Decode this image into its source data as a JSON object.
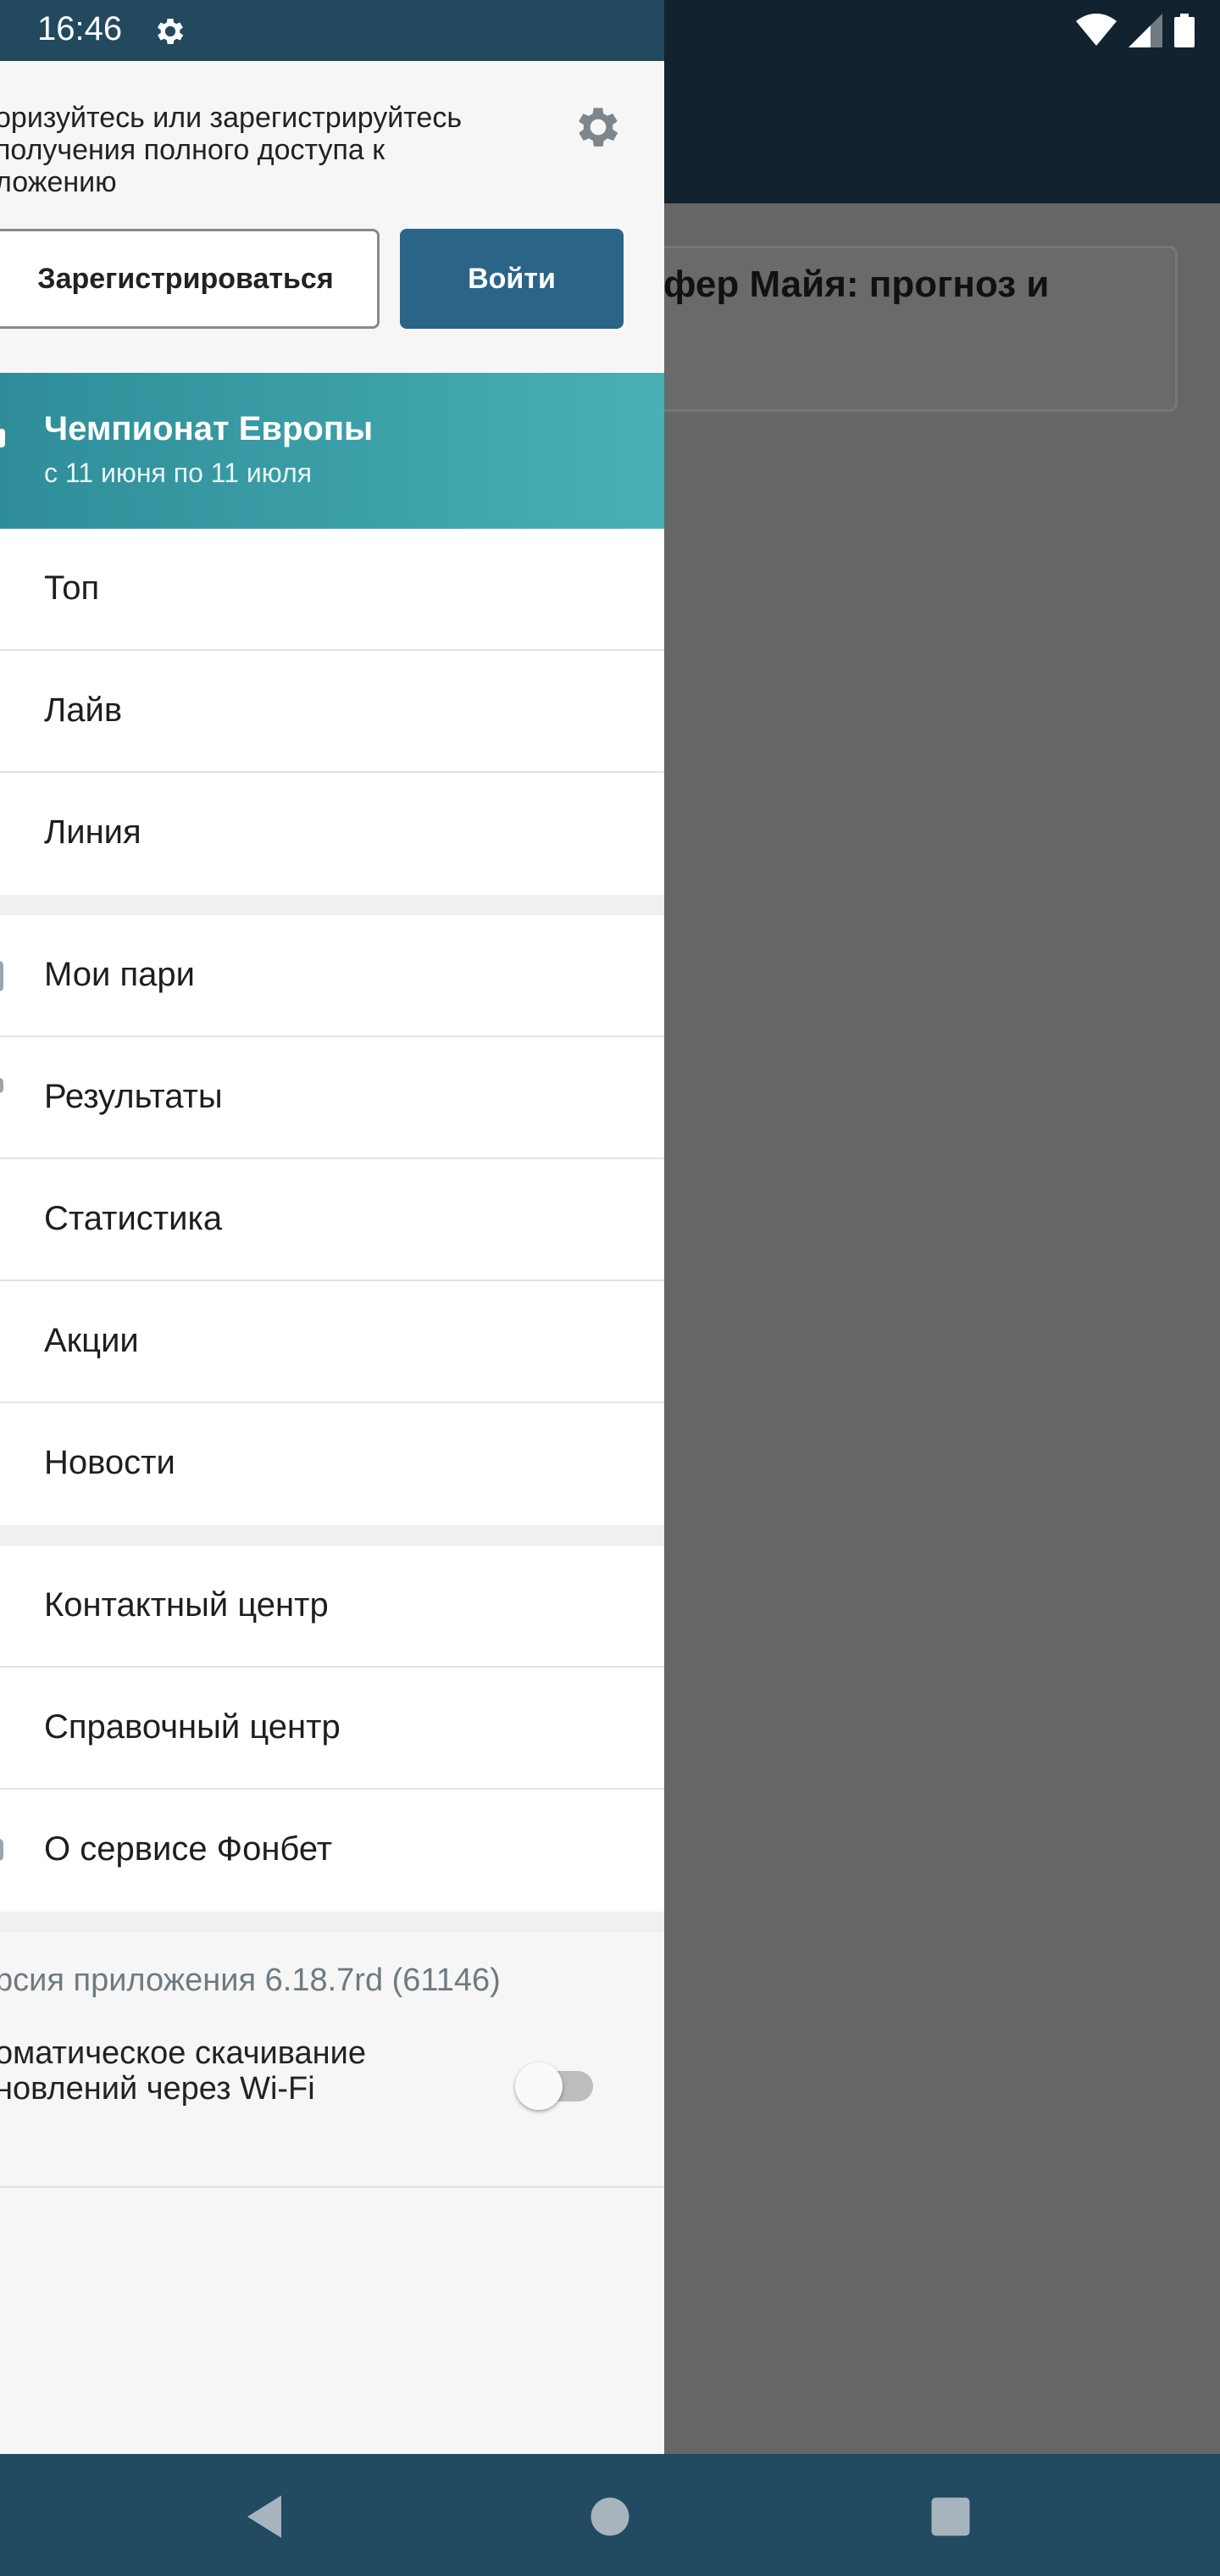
{
  "status_bar": {
    "time": "16:46",
    "icons": [
      "gear-icon",
      "wifi-icon",
      "signal-icon",
      "battery-icon"
    ]
  },
  "background_app": {
    "card_title": "фер Майя: прогноз и"
  },
  "drawer": {
    "auth_message": "оризуйтесь или зарегистрируйтесь\n получения полного доступа к\nложению",
    "register_label": "Зарегистрироваться",
    "login_label": "Войти",
    "euro": {
      "title": "Чемпионат Европы",
      "subtitle": "с 11 июня по 11 июля"
    },
    "group1": [
      {
        "label": "Топ"
      },
      {
        "label": "Лайв"
      },
      {
        "label": "Линия"
      }
    ],
    "group2": [
      {
        "label": "Мои пари"
      },
      {
        "label": "Результаты"
      },
      {
        "label": "Статистика"
      },
      {
        "label": "Акции"
      },
      {
        "label": "Новости"
      }
    ],
    "group3": [
      {
        "label": "Контактный центр"
      },
      {
        "label": "Справочный центр"
      },
      {
        "label": "О сервисе Фонбет"
      }
    ],
    "version": "рсия приложения 6.18.7rd (61146)",
    "wifi_update": "оматическое скачивание\nновлений через Wi-Fi",
    "wifi_update_enabled": false
  },
  "nav_bar": {
    "buttons": [
      "back-icon",
      "home-icon",
      "recents-icon"
    ]
  },
  "colors": {
    "accent": "#2a6487",
    "banner_start": "#2e8d99",
    "banner_end": "#49b0b5",
    "status_bar": "#23495f",
    "nav_bar": "#224a61"
  }
}
